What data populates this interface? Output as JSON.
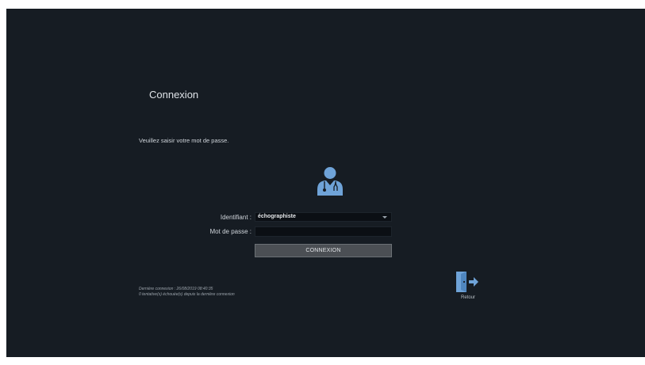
{
  "login": {
    "title": "Connexion",
    "instruction": "Veuillez saisir votre mot de passe.",
    "identifier_label": "Identifiant :",
    "identifier_value": "échographiste",
    "password_label": "Mot de passe :",
    "password_value": "",
    "connect_button": "CONNEXION",
    "last_connection": "Dernière connexion : 26/08/2019 08:40:35",
    "failed_attempts": "0 tentative(s) échouée(s) depuis la dernière connexion",
    "back_label": "Retour"
  },
  "icons": {
    "user": "doctor-user-icon",
    "back": "exit-door-icon",
    "dropdown": "chevron-down-icon"
  },
  "colors": {
    "background": "#161c23",
    "accent": "#6fa3d8",
    "button": "#4b4f54",
    "field": "#0b0f14"
  }
}
